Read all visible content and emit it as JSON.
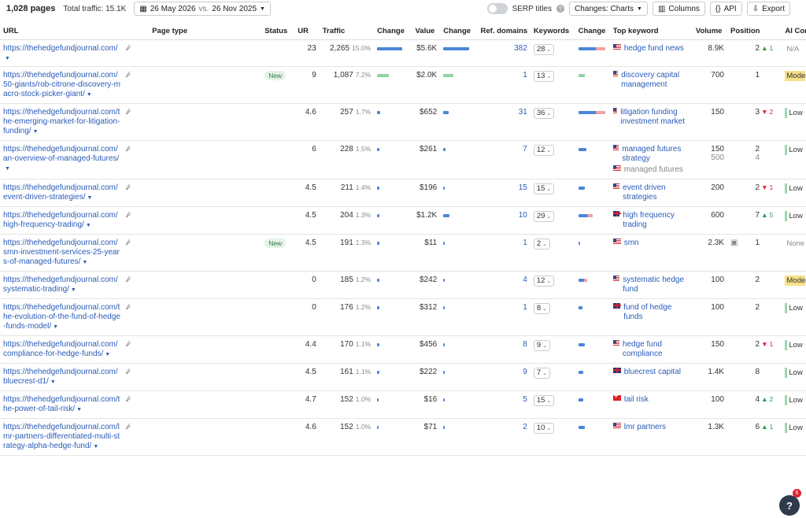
{
  "header": {
    "pages": "1,028 pages",
    "traffic": "Total traffic: 15.1K",
    "date_from": "26 May 2026",
    "vs": "vs.",
    "date_to": "26 Nov 2025",
    "serp_titles": "SERP titles",
    "changes": "Changes: Charts",
    "columns": "Columns",
    "api": "API",
    "export": "Export"
  },
  "columns": [
    "URL",
    "Page type",
    "Status",
    "UR",
    "Traffic",
    "Change",
    "Value",
    "Change",
    "Ref. domains",
    "Keywords",
    "Change",
    "Top keyword",
    "Volume",
    "Position",
    "AI Content"
  ],
  "rows": [
    {
      "url": "https://thehedgefundjournal.com/",
      "status": "",
      "ur": "23",
      "traffic": "2,265",
      "pct": "15.0%",
      "tbar": 100,
      "value": "$5.6K",
      "vbar": 100,
      "ref": "382",
      "kw": "28",
      "kbar": 100,
      "keywords": [
        "hedge fund news"
      ],
      "volume": [
        "8.9K"
      ],
      "position": [
        "2"
      ],
      "pos_change": "1",
      "pos_dir": "up",
      "ai": "N/A",
      "ai_type": "na",
      "flag": "us"
    },
    {
      "url": "https://thehedgefundjournal.com/50-giants/rob-citrone-discovery-macro-stock-picker-giant/",
      "status": "New",
      "ur": "9",
      "traffic": "1,087",
      "pct": "7.2%",
      "tbar": 45,
      "value": "$2.0K",
      "vbar": 40,
      "ref": "1",
      "kw": "13",
      "kbar": 25,
      "keywords": [
        "discovery capital management"
      ],
      "volume": [
        "700"
      ],
      "position": [
        "1"
      ],
      "pos_change": "",
      "pos_dir": "",
      "ai": "Moderate",
      "ai_type": "mod",
      "flag": "us"
    },
    {
      "url": "https://thehedgefundjournal.com/the-emerging-market-for-litigation-funding/",
      "status": "",
      "ur": "4.6",
      "traffic": "257",
      "pct": "1.7%",
      "tbar": 12,
      "value": "$652",
      "vbar": 22,
      "ref": "31",
      "kw": "36",
      "kbar": 100,
      "keywords": [
        "litigation funding investment market"
      ],
      "volume": [
        "150"
      ],
      "position": [
        "3"
      ],
      "pos_change": "2",
      "pos_dir": "down",
      "ai": "Low",
      "ai_type": "low",
      "flag": "us"
    },
    {
      "url": "https://thehedgefundjournal.com/an-overview-of-managed-futures/",
      "status": "",
      "ur": "6",
      "traffic": "228",
      "pct": "1.5%",
      "tbar": 8,
      "value": "$261",
      "vbar": 8,
      "ref": "7",
      "kw": "12",
      "kbar": 30,
      "keywords": [
        "managed futures strategy",
        "managed futures"
      ],
      "volume": [
        "150",
        "500"
      ],
      "position": [
        "2",
        "4"
      ],
      "pos_change": "",
      "pos_dir": "",
      "ai": "Low",
      "ai_type": "low",
      "flag": "us"
    },
    {
      "url": "https://thehedgefundjournal.com/event-driven-strategies/",
      "status": "",
      "ur": "4.5",
      "traffic": "211",
      "pct": "1.4%",
      "tbar": 10,
      "value": "$196",
      "vbar": 5,
      "ref": "15",
      "kw": "15",
      "kbar": 25,
      "keywords": [
        "event driven strategies"
      ],
      "volume": [
        "200"
      ],
      "position": [
        "2"
      ],
      "pos_change": "1",
      "pos_dir": "down",
      "ai": "Low",
      "ai_type": "low",
      "flag": "us"
    },
    {
      "url": "https://thehedgefundjournal.com/high-frequency-trading/",
      "status": "",
      "ur": "4.5",
      "traffic": "204",
      "pct": "1.3%",
      "tbar": 8,
      "value": "$1.2K",
      "vbar": 25,
      "ref": "10",
      "kw": "29",
      "kbar": 55,
      "keywords": [
        "high frequency trading"
      ],
      "volume": [
        "600"
      ],
      "position": [
        "7"
      ],
      "pos_change": "5",
      "pos_dir": "up",
      "ai": "Low",
      "ai_type": "low",
      "flag": "gb"
    },
    {
      "url": "https://thehedgefundjournal.com/smn-investment-services-25-years-of-managed-futures/",
      "status": "New",
      "ur": "4.5",
      "traffic": "191",
      "pct": "1.3%",
      "tbar": 8,
      "value": "$11",
      "vbar": 3,
      "ref": "1",
      "kw": "2",
      "kbar": 5,
      "keywords": [
        "smn"
      ],
      "volume": [
        "2.3K"
      ],
      "position": [
        "1"
      ],
      "pos_change": "",
      "pos_dir": "",
      "ai": "None",
      "ai_type": "none",
      "flag": "us"
    },
    {
      "url": "https://thehedgefundjournal.com/systematic-trading/",
      "status": "",
      "ur": "0",
      "traffic": "185",
      "pct": "1.2%",
      "tbar": 10,
      "value": "$242",
      "vbar": 5,
      "ref": "4",
      "kw": "12",
      "kbar": 35,
      "keywords": [
        "systematic hedge fund"
      ],
      "volume": [
        "100"
      ],
      "position": [
        "2"
      ],
      "pos_change": "",
      "pos_dir": "",
      "ai": "Moderate",
      "ai_type": "mod",
      "flag": "us"
    },
    {
      "url": "https://thehedgefundjournal.com/the-evolution-of-the-fund-of-hedge-funds-model/",
      "status": "",
      "ur": "0",
      "traffic": "176",
      "pct": "1.2%",
      "tbar": 8,
      "value": "$312",
      "vbar": 5,
      "ref": "1",
      "kw": "8",
      "kbar": 15,
      "keywords": [
        "fund of hedge funds"
      ],
      "volume": [
        "100"
      ],
      "position": [
        "2"
      ],
      "pos_change": "",
      "pos_dir": "",
      "ai": "Low",
      "ai_type": "low",
      "flag": "gb"
    },
    {
      "url": "https://thehedgefundjournal.com/compliance-for-hedge-funds/",
      "status": "",
      "ur": "4.4",
      "traffic": "170",
      "pct": "1.1%",
      "tbar": 8,
      "value": "$456",
      "vbar": 5,
      "ref": "8",
      "kw": "9",
      "kbar": 25,
      "keywords": [
        "hedge fund compliance"
      ],
      "volume": [
        "150"
      ],
      "position": [
        "2"
      ],
      "pos_change": "1",
      "pos_dir": "down",
      "ai": "Low",
      "ai_type": "low",
      "flag": "us"
    },
    {
      "url": "https://thehedgefundjournal.com/bluecrest-d1/",
      "status": "",
      "ur": "4.5",
      "traffic": "161",
      "pct": "1.1%",
      "tbar": 8,
      "value": "$222",
      "vbar": 5,
      "ref": "9",
      "kw": "7",
      "kbar": 20,
      "keywords": [
        "bluecrest capital"
      ],
      "volume": [
        "1.4K"
      ],
      "position": [
        "8"
      ],
      "pos_change": "",
      "pos_dir": "",
      "ai": "Low",
      "ai_type": "low",
      "flag": "gb"
    },
    {
      "url": "https://thehedgefundjournal.com/the-power-of-tail-risk/",
      "status": "",
      "ur": "4.7",
      "traffic": "152",
      "pct": "1.0%",
      "tbar": 6,
      "value": "$16",
      "vbar": 3,
      "ref": "5",
      "kw": "15",
      "kbar": 20,
      "keywords": [
        "tail risk"
      ],
      "volume": [
        "100"
      ],
      "position": [
        "4"
      ],
      "pos_change": "2",
      "pos_dir": "up",
      "ai": "Low",
      "ai_type": "low",
      "flag": "ch"
    },
    {
      "url": "https://thehedgefundjournal.com/lmr-partners-differentiated-multi-strategy-alpha-hedge-fund/",
      "status": "",
      "ur": "4.6",
      "traffic": "152",
      "pct": "1.0%",
      "tbar": 6,
      "value": "$71",
      "vbar": 3,
      "ref": "2",
      "kw": "10",
      "kbar": 25,
      "keywords": [
        "lmr partners"
      ],
      "volume": [
        "1.3K"
      ],
      "position": [
        "6"
      ],
      "pos_change": "1",
      "pos_dir": "up",
      "ai": "Low",
      "ai_type": "low",
      "flag": "us"
    }
  ],
  "fab": {
    "label": "?",
    "badge": "6"
  }
}
